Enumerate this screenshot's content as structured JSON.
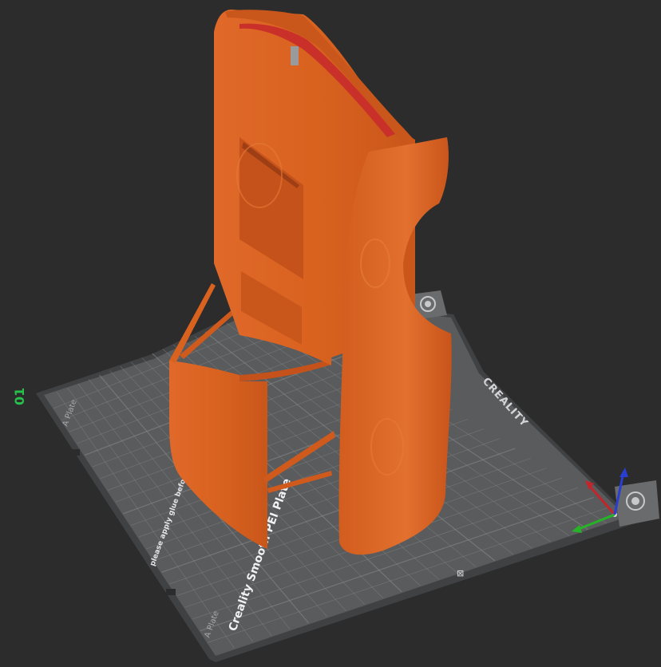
{
  "plate": {
    "number": "01",
    "label_top": "A Plate",
    "label_bottom": "A Plate",
    "brand": "CREALITY",
    "title": "Creality Smooth PEI Plate",
    "notice": "please apply glue before print",
    "plate_color": "#5a5b5d",
    "edge_color": "#404143",
    "grid_color": "#8a8b8e"
  },
  "model": {
    "color": "#d9621f",
    "shade": "#b8501a",
    "highlight": "#e67a35",
    "inner_color": "#c9302a"
  },
  "axes": {
    "x_color": "#c2262b",
    "y_color": "#27b327",
    "z_color": "#2a3fd1"
  }
}
